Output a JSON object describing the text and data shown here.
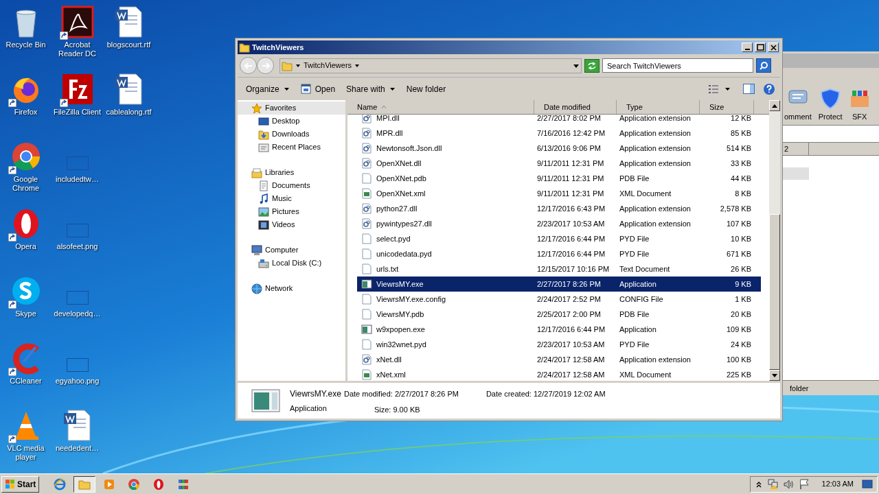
{
  "desktop": {
    "columns": [
      [
        {
          "label": "Recycle Bin",
          "kind": "recycle",
          "shortcut": false
        },
        {
          "label": "Firefox",
          "kind": "firefox",
          "shortcut": true
        },
        {
          "label": "Google Chrome",
          "kind": "chrome",
          "shortcut": true
        },
        {
          "label": "Opera",
          "kind": "opera",
          "shortcut": true
        },
        {
          "label": "Skype",
          "kind": "skype",
          "shortcut": true
        },
        {
          "label": "CCleaner",
          "kind": "ccleaner",
          "shortcut": true
        },
        {
          "label": "VLC media player",
          "kind": "vlc",
          "shortcut": true
        }
      ],
      [
        {
          "label": "Acrobat Reader DC",
          "kind": "acrobat",
          "shortcut": true
        },
        {
          "label": "FileZilla Client",
          "kind": "filezilla",
          "shortcut": true
        },
        {
          "label": "includedtw…",
          "kind": "blank",
          "shortcut": false
        },
        {
          "label": "alsofeet.png",
          "kind": "blank",
          "shortcut": false
        },
        {
          "label": "developedq…",
          "kind": "blank",
          "shortcut": false
        },
        {
          "label": "egyahoo.png",
          "kind": "blank",
          "shortcut": false
        },
        {
          "label": "neededent…",
          "kind": "word",
          "shortcut": false
        }
      ],
      [
        {
          "label": "blogscourt.rtf",
          "kind": "word",
          "shortcut": false
        },
        {
          "label": "cablealong.rtf",
          "kind": "word",
          "shortcut": false
        }
      ]
    ]
  },
  "background_window": {
    "toolbar": [
      {
        "label": "omment",
        "kind": "comment"
      },
      {
        "label": "Protect",
        "kind": "shield"
      },
      {
        "label": "SFX",
        "kind": "box"
      }
    ],
    "column": "2",
    "status_bar": "folder"
  },
  "window": {
    "title": "TwitchViewers",
    "address": "TwitchViewers",
    "search": {
      "placeholder": "Search TwitchViewers"
    },
    "toolbar": [
      {
        "label": "Organize",
        "kind": "menu"
      },
      {
        "label": "Open",
        "kind": "open"
      },
      {
        "label": "Share with",
        "kind": "menu"
      },
      {
        "label": "New folder",
        "kind": "plain"
      }
    ],
    "sidebar": [
      {
        "label": "Favorites",
        "kind": "star",
        "selected": true,
        "children": [
          {
            "label": "Desktop",
            "kind": "desktop",
            "selected": false
          },
          {
            "label": "Downloads",
            "kind": "downloads",
            "selected": false
          },
          {
            "label": "Recent Places",
            "kind": "recent",
            "selected": false
          }
        ]
      },
      {
        "label": "Libraries",
        "kind": "libraries",
        "selected": false,
        "children": [
          {
            "label": "Documents",
            "kind": "documents",
            "selected": false
          },
          {
            "label": "Music",
            "kind": "music",
            "selected": false
          },
          {
            "label": "Pictures",
            "kind": "pictures",
            "selected": false
          },
          {
            "label": "Videos",
            "kind": "videos",
            "selected": false
          }
        ]
      },
      {
        "label": "Computer",
        "kind": "computer",
        "selected": false,
        "children": [
          {
            "label": "Local Disk (C:)",
            "kind": "disk",
            "selected": false
          }
        ]
      },
      {
        "label": "Network",
        "kind": "network",
        "selected": false
      }
    ],
    "table": {
      "columns": [
        "Name",
        "Date modified",
        "Type",
        "Size"
      ],
      "rows": [
        {
          "name": "MPI.dll",
          "date": "2/27/2017 8:02 PM",
          "type": "Application extension",
          "size": "12 KB",
          "kind": "dll",
          "selected": false
        },
        {
          "name": "MPR.dll",
          "date": "7/16/2016 12:42 PM",
          "type": "Application extension",
          "size": "85 KB",
          "kind": "dll",
          "selected": false
        },
        {
          "name": "Newtonsoft.Json.dll",
          "date": "6/13/2016 9:06 PM",
          "type": "Application extension",
          "size": "514 KB",
          "kind": "dll",
          "selected": false
        },
        {
          "name": "OpenXNet.dll",
          "date": "9/11/2011 12:31 PM",
          "type": "Application extension",
          "size": "33 KB",
          "kind": "dll",
          "selected": false
        },
        {
          "name": "OpenXNet.pdb",
          "date": "9/11/2011 12:31 PM",
          "type": "PDB File",
          "size": "44 KB",
          "kind": "file",
          "selected": false
        },
        {
          "name": "OpenXNet.xml",
          "date": "9/11/2011 12:31 PM",
          "type": "XML Document",
          "size": "8 KB",
          "kind": "xml",
          "selected": false
        },
        {
          "name": "python27.dll",
          "date": "12/17/2016 6:43 PM",
          "type": "Application extension",
          "size": "2,578 KB",
          "kind": "dll",
          "selected": false
        },
        {
          "name": "pywintypes27.dll",
          "date": "2/23/2017 10:53 AM",
          "type": "Application extension",
          "size": "107 KB",
          "kind": "dll",
          "selected": false
        },
        {
          "name": "select.pyd",
          "date": "12/17/2016 6:44 PM",
          "type": "PYD File",
          "size": "10 KB",
          "kind": "file",
          "selected": false
        },
        {
          "name": "unicodedata.pyd",
          "date": "12/17/2016 6:44 PM",
          "type": "PYD File",
          "size": "671 KB",
          "kind": "file",
          "selected": false
        },
        {
          "name": "urls.txt",
          "date": "12/15/2017 10:16 PM",
          "type": "Text Document",
          "size": "26 KB",
          "kind": "file",
          "selected": false
        },
        {
          "name": "ViewrsMY.exe",
          "date": "2/27/2017 8:26 PM",
          "type": "Application",
          "size": "9 KB",
          "kind": "exe",
          "selected": true
        },
        {
          "name": "ViewrsMY.exe.config",
          "date": "2/24/2017 2:52 PM",
          "type": "CONFIG File",
          "size": "1 KB",
          "kind": "file",
          "selected": false
        },
        {
          "name": "ViewrsMY.pdb",
          "date": "2/25/2017 2:00 PM",
          "type": "PDB File",
          "size": "20 KB",
          "kind": "file",
          "selected": false
        },
        {
          "name": "w9xpopen.exe",
          "date": "12/17/2016 6:44 PM",
          "type": "Application",
          "size": "109 KB",
          "kind": "exe",
          "selected": false
        },
        {
          "name": "win32wnet.pyd",
          "date": "2/23/2017 10:53 AM",
          "type": "PYD File",
          "size": "24 KB",
          "kind": "file",
          "selected": false
        },
        {
          "name": "xNet.dll",
          "date": "2/24/2017 12:58 AM",
          "type": "Application extension",
          "size": "100 KB",
          "kind": "dll",
          "selected": false
        },
        {
          "name": "xNet.xml",
          "date": "2/24/2017 12:58 AM",
          "type": "XML Document",
          "size": "225 KB",
          "kind": "xml",
          "selected": false
        }
      ]
    },
    "details": {
      "name": "ViewrsMY.exe",
      "type": "Application",
      "fields": [
        {
          "label": "Date modified:",
          "value": "2/27/2017 8:26 PM"
        },
        {
          "label": "Date created:",
          "value": "12/27/2019 12:02 AM"
        },
        {
          "label": "Size:",
          "value": "9.00 KB"
        }
      ]
    }
  },
  "taskbar": {
    "start": "Start",
    "apps": [
      {
        "kind": "ie",
        "selected": false
      },
      {
        "kind": "folder",
        "selected": true
      },
      {
        "kind": "media",
        "selected": false
      },
      {
        "kind": "chrome",
        "selected": false
      },
      {
        "kind": "opera",
        "selected": false
      },
      {
        "kind": "winrar",
        "selected": false
      }
    ],
    "clock": "12:03 AM"
  }
}
